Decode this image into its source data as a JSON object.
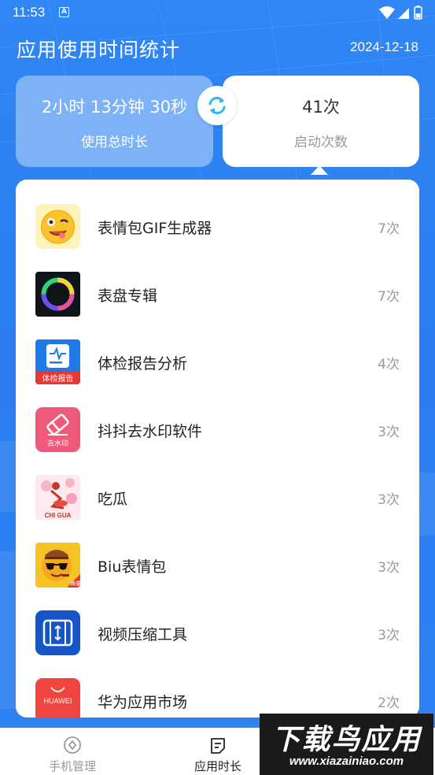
{
  "status_bar": {
    "time": "11:53",
    "notification_icon": "A"
  },
  "header": {
    "title": "应用使用时间统计",
    "date": "2024-12-18"
  },
  "stats": {
    "total_time_value": "2小时 13分钟 30秒",
    "total_time_label": "使用总时长",
    "launch_count_value": "41次",
    "launch_count_label": "启动次数",
    "selected": "launch_count"
  },
  "apps": [
    {
      "name": "表情包GIF生成器",
      "count": "7次",
      "icon": "emoji-gif-icon"
    },
    {
      "name": "表盘专辑",
      "count": "7次",
      "icon": "watchface-ring-icon"
    },
    {
      "name": "体检报告分析",
      "count": "4次",
      "icon": "health-report-icon",
      "icon_text": "体检报告"
    },
    {
      "name": "抖抖去水印软件",
      "count": "3次",
      "icon": "eraser-icon",
      "icon_text": "去水印"
    },
    {
      "name": "吃瓜",
      "count": "3次",
      "icon": "chigua-icon",
      "icon_text": "CHI GUA"
    },
    {
      "name": "Biu表情包",
      "count": "3次",
      "icon": "sunglasses-emoji-icon",
      "icon_text": "海量"
    },
    {
      "name": "视频压缩工具",
      "count": "3次",
      "icon": "video-compress-icon"
    },
    {
      "name": "华为应用市场",
      "count": "2次",
      "icon": "huawei-appgallery-icon",
      "icon_text": "HUAWEI"
    }
  ],
  "nav": [
    {
      "label": "手机管理",
      "icon": "phone-manage-icon",
      "active": false
    },
    {
      "label": "应用时长",
      "icon": "app-duration-icon",
      "active": true
    }
  ],
  "watermark": {
    "title": "下载鸟应用",
    "site": "www.xiazainiao.com"
  },
  "colors": {
    "background": "#2f80f0",
    "stat_inactive": "#7db2f7",
    "accent_cyan": "#2bbbe6",
    "nav_active": "#222222",
    "nav_inactive": "#999999"
  }
}
